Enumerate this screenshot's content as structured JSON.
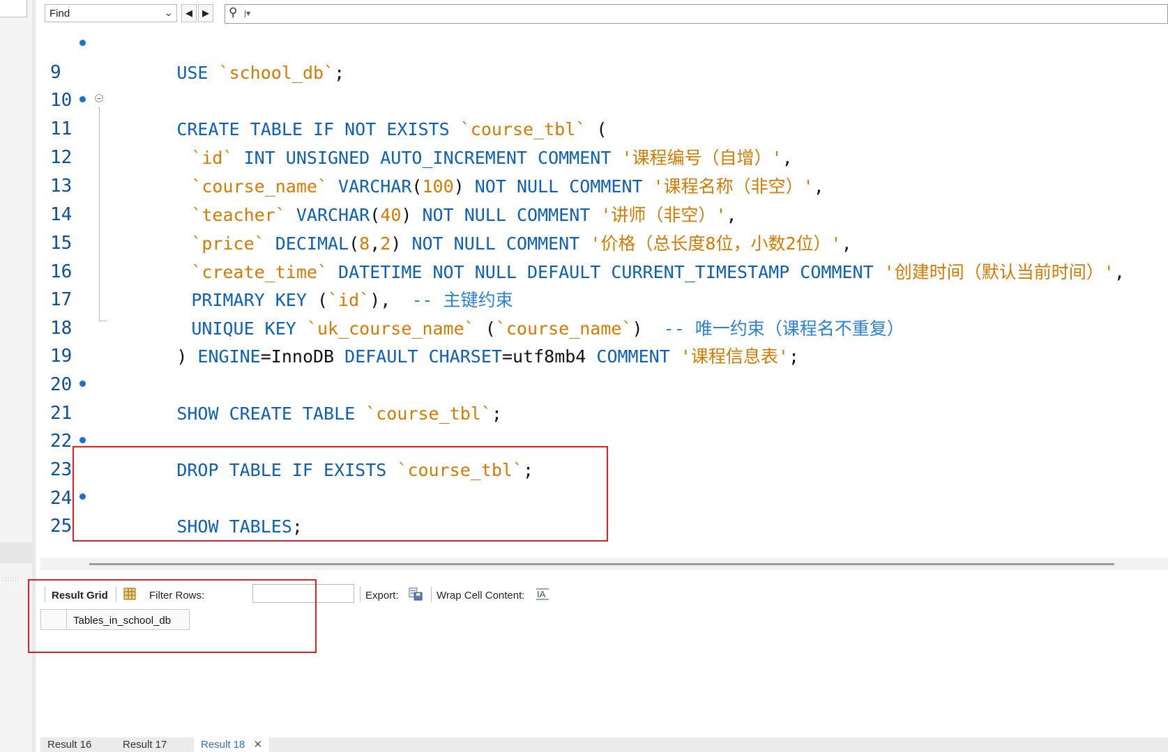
{
  "find_bar": {
    "mode_label": "Find",
    "search_placeholder": ""
  },
  "editor": {
    "lines": [
      {
        "num": "9"
      },
      {
        "num": "10"
      },
      {
        "num": "11"
      },
      {
        "num": "12"
      },
      {
        "num": "13"
      },
      {
        "num": "14"
      },
      {
        "num": "15"
      },
      {
        "num": "16"
      },
      {
        "num": "17"
      },
      {
        "num": "18"
      },
      {
        "num": "19"
      },
      {
        "num": "20"
      },
      {
        "num": "21"
      },
      {
        "num": "22"
      },
      {
        "num": "23"
      },
      {
        "num": "24"
      },
      {
        "num": "25"
      }
    ],
    "code": {
      "l9": [
        "USE",
        " ",
        "`school_db`",
        ";"
      ],
      "l11": [
        "CREATE TABLE IF NOT EXISTS",
        " ",
        "`course_tbl`",
        " ("
      ],
      "l12": [
        "`id`",
        " ",
        "INT UNSIGNED AUTO_INCREMENT COMMENT",
        " ",
        "'课程编号（自增）'",
        ","
      ],
      "l13": [
        "`course_name`",
        " ",
        "VARCHAR",
        "(",
        "100",
        ") ",
        "NOT NULL COMMENT",
        " ",
        "'课程名称（非空）'",
        ","
      ],
      "l14": [
        "`teacher`",
        " ",
        "VARCHAR",
        "(",
        "40",
        ") ",
        "NOT NULL COMMENT",
        " ",
        "'讲师（非空）'",
        ","
      ],
      "l15": [
        "`price`",
        " ",
        "DECIMAL",
        "(",
        "8",
        ",",
        "2",
        ") ",
        "NOT NULL COMMENT",
        " ",
        "'价格（总长度8位，小数2位）'",
        ","
      ],
      "l16": [
        "`create_time`",
        " ",
        "DATETIME NOT NULL DEFAULT CURRENT_TIMESTAMP COMMENT",
        " ",
        "'创建时间（默认当前时间）'",
        ","
      ],
      "l17": [
        "PRIMARY KEY",
        " (",
        "`id`",
        "),  ",
        "-- 主键约束"
      ],
      "l18": [
        "UNIQUE KEY",
        " ",
        "`uk_course_name`",
        " (",
        "`course_name`",
        ")  ",
        "-- 唯一约束（课程名不重复）"
      ],
      "l19": [
        ") ",
        "ENGINE",
        "=InnoDB ",
        "DEFAULT CHARSET",
        "=utf8mb4 ",
        "COMMENT",
        " ",
        "'课程信息表'",
        ";"
      ],
      "l21": [
        "SHOW CREATE TABLE",
        " ",
        "`course_tbl`",
        ";"
      ],
      "l23": [
        "DROP TABLE IF EXISTS",
        " ",
        "`course_tbl`",
        ";"
      ],
      "l25": [
        "SHOW TABLES",
        ";"
      ]
    }
  },
  "result_toolbar": {
    "result_grid_label": "Result Grid",
    "filter_rows_label": "Filter Rows:",
    "filter_value": "",
    "export_label": "Export:",
    "wrap_label": "Wrap Cell Content:"
  },
  "grid": {
    "columns": [
      "Tables_in_school_db"
    ],
    "rows": []
  },
  "tabs": [
    {
      "label": "Result 16",
      "active": false
    },
    {
      "label": "Result 17",
      "active": false
    },
    {
      "label": "Result 18",
      "active": true
    }
  ],
  "colors": {
    "keyword": "#0c60b5",
    "string": "#d67a00",
    "line_number": "#0b4fa0",
    "annotation": "#e02020"
  }
}
